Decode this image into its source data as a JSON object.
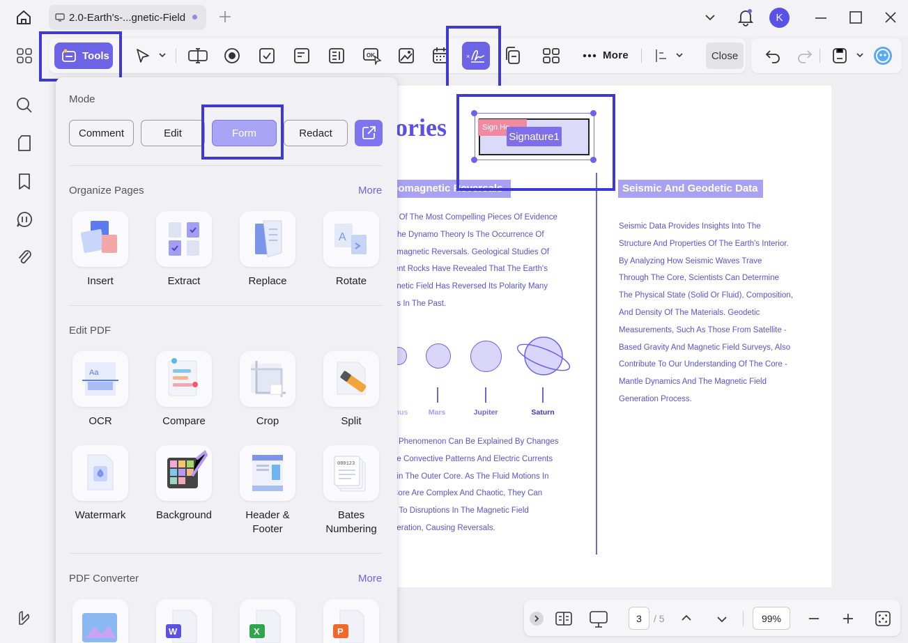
{
  "titlebar": {
    "tab_title": "2.0-Earth's-...gnetic-Field",
    "avatar_initial": "K"
  },
  "toolbar": {
    "tools_label": "Tools",
    "more_label": "More",
    "close_label": "Close"
  },
  "document": {
    "title_fragment": "ories",
    "left_heading": "eomagnetic Reversals",
    "right_heading": "Seismic And Geodetic Data",
    "left_para1": [
      "e Of The Most Compelling Pieces Of Evidence",
      "The Dynamo Theory Is The Occurrence Of",
      "omagnetic Reversals. Geological Studies Of",
      "ient Rocks Have Revealed That The Earth's",
      "gnetic Field Has Reversed Its Polarity Many",
      "es In The Past."
    ],
    "right_para": [
      "Seismic Data Provides Insights Into The",
      "Structure And Properties Of The Earth's Interior.",
      "By Analyzing How Seismic Waves Trave",
      "Through The Core, Scientists Can Determine",
      "The Physical State (Solid Or Fluid), Composition,",
      "And Density Of The Materials. Geodetic",
      "Measurements, Such As Those From Satellite -",
      "Based Gravity And Magnetic Field Surveys, Also",
      "Contribute To Our Understanding Of The Core -",
      "Mantle Dynamics And The Magnetic Field",
      "Generation Process."
    ],
    "left_para2": [
      "s Phenomenon Can Be Explained By Changes",
      "he Convective Patterns And Electric Currents",
      "hin The Outer Core. As The Fluid Motions In",
      "Core Are Complex And Chaotic, They Can",
      "d To Disruptions In The Magnetic Field",
      "neration, Causing Reversals."
    ],
    "planets": [
      "nus",
      "Mars",
      "Jupiter",
      "Saturn"
    ],
    "sign_here": "Sign He",
    "signature_label": "Signature1"
  },
  "panel": {
    "mode_title": "Mode",
    "modes": [
      "Comment",
      "Edit",
      "Form",
      "Redact"
    ],
    "organize_title": "Organize Pages",
    "organize_more": "More",
    "organize_items": [
      "Insert",
      "Extract",
      "Replace",
      "Rotate"
    ],
    "edit_title": "Edit PDF",
    "edit_items": [
      "OCR",
      "Compare",
      "Crop",
      "Split",
      "Watermark",
      "Background",
      "Header & Footer",
      "Bates Numbering"
    ],
    "converter_title": "PDF Converter",
    "converter_more": "More"
  },
  "bottombar": {
    "page_current": "3",
    "page_total": "/ 5",
    "zoom": "99%"
  },
  "colors": {
    "accent": "#6c63e7",
    "highlight": "#3d38d6",
    "doc_text": "#5a52d8"
  }
}
